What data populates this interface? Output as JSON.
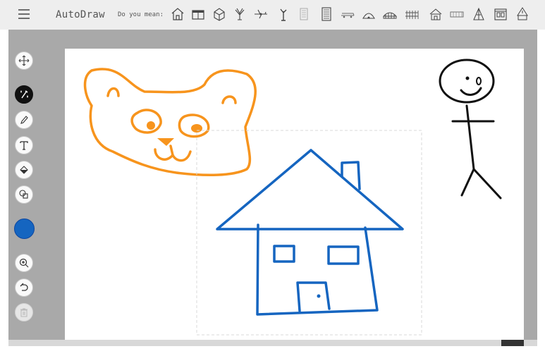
{
  "app": {
    "title": "AutoDraw",
    "menu_icon": "hamburger-menu-icon"
  },
  "suggestions": {
    "label": "Do you mean:",
    "items": [
      "house",
      "cabinet",
      "cube-house",
      "plant",
      "plane",
      "tree",
      "building",
      "office-building",
      "train",
      "igloo",
      "stadium",
      "fence",
      "barn",
      "wall",
      "tent",
      "window-frame",
      "church"
    ]
  },
  "toolbar": {
    "tools": [
      {
        "name": "move-tool",
        "icon": "move-arrows-icon",
        "active": false,
        "enabled": true
      },
      {
        "name": "autodraw-tool",
        "icon": "autodraw-magic-icon",
        "active": true,
        "enabled": true
      },
      {
        "name": "draw-tool",
        "icon": "pencil-icon",
        "active": false,
        "enabled": true
      },
      {
        "name": "type-tool",
        "icon": "text-icon",
        "active": false,
        "enabled": true
      },
      {
        "name": "fill-tool",
        "icon": "paint-bucket-icon",
        "active": false,
        "enabled": true
      },
      {
        "name": "shape-tool",
        "icon": "shapes-icon",
        "active": false,
        "enabled": true
      }
    ],
    "current_color": "#1565c0",
    "actions": [
      {
        "name": "zoom-tool",
        "icon": "zoom-in-icon",
        "enabled": true
      },
      {
        "name": "undo-tool",
        "icon": "undo-icon",
        "enabled": true
      },
      {
        "name": "delete-tool",
        "icon": "trash-icon",
        "enabled": false
      }
    ]
  },
  "canvas": {
    "background": "#ffffff",
    "drawings": [
      {
        "name": "bear",
        "color": "#f7941d"
      },
      {
        "name": "house",
        "color": "#1565c0",
        "selected": true
      },
      {
        "name": "stick-figure",
        "color": "#111111"
      }
    ]
  }
}
